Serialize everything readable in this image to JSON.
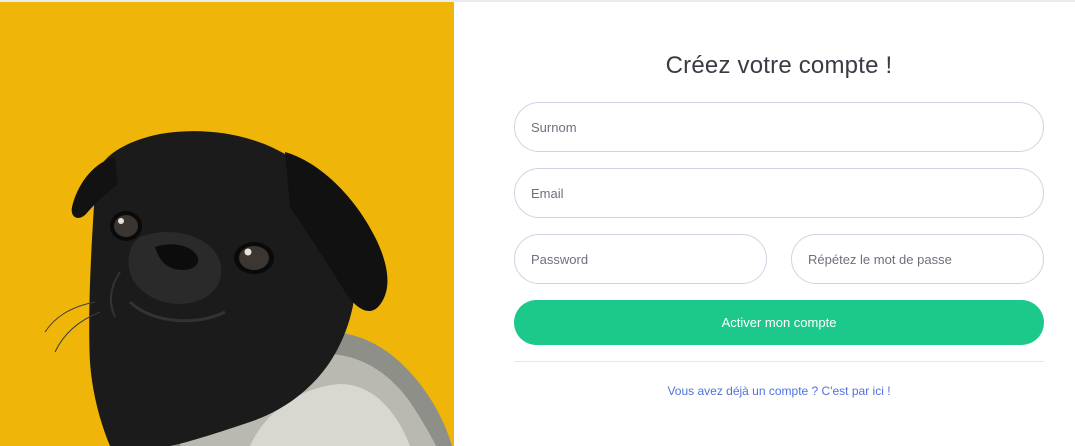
{
  "form": {
    "title": "Créez votre compte !",
    "surname_placeholder": "Surnom",
    "email_placeholder": "Email",
    "password_placeholder": "Password",
    "repeat_password_placeholder": "Répétez le mot de passe",
    "submit_label": "Activer mon compte",
    "login_link": "Vous avez déjà un compte ? C'est par ici !"
  },
  "image": {
    "subject": "pug-photo",
    "background_color": "#efb508"
  },
  "colors": {
    "accent_button": "#1cc88a",
    "link": "#4e73df",
    "input_border": "#d1d3e2"
  }
}
